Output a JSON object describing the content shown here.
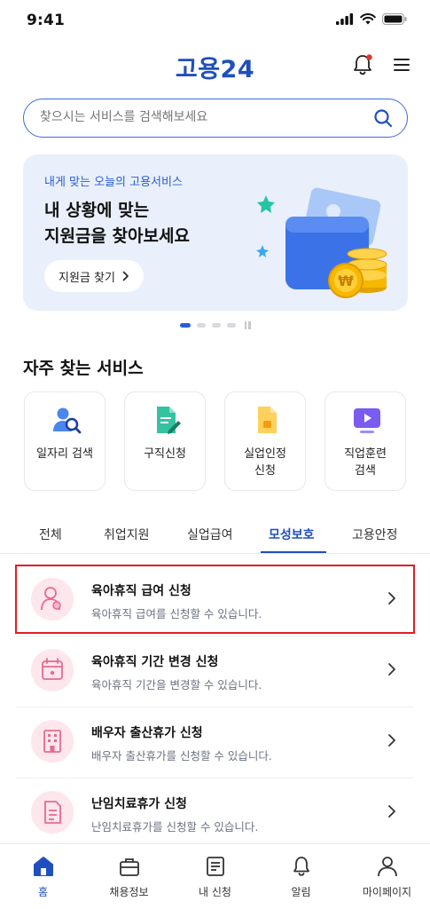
{
  "status": {
    "time": "9:41"
  },
  "header": {
    "logo": "고용24"
  },
  "search": {
    "placeholder": "찾으시는 서비스를 검색해보세요"
  },
  "banner": {
    "subtitle": "내게 맞는 오늘의 고용서비스",
    "title": "내 상황에 맞는\n지원금을 찾아보세요",
    "button_label": "지원금 찾기",
    "page_count": 4,
    "active_page": 1
  },
  "services_section": {
    "title": "자주 찾는 서비스",
    "items": [
      {
        "label": "일자리 검색",
        "icon": "person-search-icon"
      },
      {
        "label": "구직신청",
        "icon": "document-pen-icon"
      },
      {
        "label": "실업인정\n신청",
        "icon": "document-yellow-icon"
      },
      {
        "label": "직업훈련\n검색",
        "icon": "video-training-icon"
      }
    ]
  },
  "tabs": [
    {
      "label": "전체",
      "active": false
    },
    {
      "label": "취업지원",
      "active": false
    },
    {
      "label": "실업급여",
      "active": false
    },
    {
      "label": "모성보호",
      "active": true
    },
    {
      "label": "고용안정",
      "active": false
    }
  ],
  "list": [
    {
      "title": "육아휴직 급여 신청",
      "desc": "육아휴직 급여를 신청할 수 있습니다.",
      "icon": "mother-child-icon",
      "selected": true
    },
    {
      "title": "육아휴직 기간 변경 신청",
      "desc": "육아휴직 기간을 변경할 수 있습니다.",
      "icon": "calendar-icon",
      "selected": false
    },
    {
      "title": "배우자 출산휴가 신청",
      "desc": "배우자 출산휴가를 신청할 수 있습니다.",
      "icon": "building-icon",
      "selected": false
    },
    {
      "title": "난임치료휴가 신청",
      "desc": "난임치료휴가를 신청할 수 있습니다.",
      "icon": "document-icon",
      "selected": false
    }
  ],
  "bottom_nav": [
    {
      "label": "홈",
      "icon": "home-icon",
      "active": true
    },
    {
      "label": "채용정보",
      "icon": "briefcase-icon",
      "active": false
    },
    {
      "label": "내 신청",
      "icon": "clipboard-icon",
      "active": false
    },
    {
      "label": "알림",
      "icon": "bell-icon",
      "active": false
    },
    {
      "label": "마이페이지",
      "icon": "person-icon",
      "active": false
    }
  ],
  "colors": {
    "brand": "#1f4fbf",
    "accent_pink": "#fde6ec",
    "highlight_red": "#e01d25",
    "banner_bg": "#e9f0fb"
  }
}
